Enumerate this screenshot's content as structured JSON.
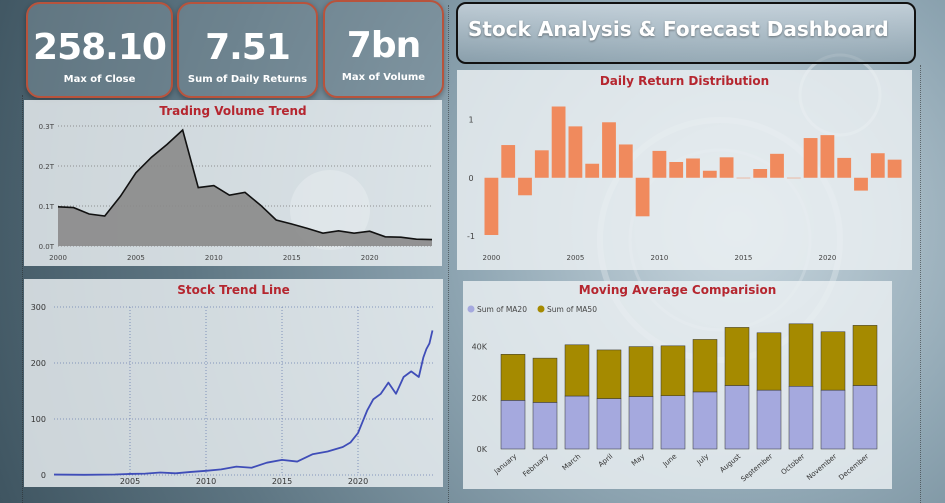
{
  "kpis": [
    {
      "value": "258.10",
      "label": "Max of Close"
    },
    {
      "value": "7.51",
      "label": "Sum of Daily Returns"
    },
    {
      "value": "7bn",
      "label": "Max of Volume"
    }
  ],
  "dashboard_title": "Stock Analysis & Forecast Dashboard",
  "colors": {
    "volume_fill": "#8a8a8a",
    "returns_bar": "#f08a5d",
    "trend_line": "#3f4db8",
    "ma20": "#a5a9de",
    "ma50": "#a58a00",
    "title_red": "#b5262f"
  },
  "chart_data": [
    {
      "type": "area",
      "title": "Trading Volume Trend",
      "x": [
        2000,
        2001,
        2002,
        2003,
        2004,
        2005,
        2006,
        2007,
        2008,
        2009,
        2010,
        2011,
        2012,
        2013,
        2014,
        2015,
        2016,
        2017,
        2018,
        2019,
        2020,
        2021,
        2022,
        2023,
        2024
      ],
      "values": [
        0.098,
        0.096,
        0.08,
        0.075,
        0.124,
        0.183,
        0.222,
        0.254,
        0.29,
        0.146,
        0.151,
        0.127,
        0.134,
        0.102,
        0.065,
        0.055,
        0.044,
        0.032,
        0.038,
        0.032,
        0.037,
        0.023,
        0.022,
        0.017,
        0.016
      ],
      "xticks": [
        "2000",
        "2005",
        "2010",
        "2015",
        "2020"
      ],
      "xtick_values": [
        2000,
        2005,
        2010,
        2015,
        2020
      ],
      "yticks": [
        "0.0T",
        "0.1T",
        "0.2T",
        "0.3T"
      ],
      "ytick_values": [
        0,
        0.1,
        0.2,
        0.3
      ],
      "xlim": [
        2000,
        2024
      ],
      "ylim": [
        0,
        0.3
      ],
      "grid": true
    },
    {
      "type": "bar",
      "title": "Daily Return Distribution",
      "x": [
        2000,
        2001,
        2002,
        2003,
        2004,
        2005,
        2006,
        2007,
        2008,
        2009,
        2010,
        2011,
        2012,
        2013,
        2014,
        2015,
        2016,
        2017,
        2018,
        2019,
        2020,
        2021,
        2022,
        2023,
        2024
      ],
      "values": [
        -0.98,
        0.56,
        -0.3,
        0.47,
        1.22,
        0.88,
        0.24,
        0.95,
        0.57,
        -0.66,
        0.46,
        0.27,
        0.33,
        0.12,
        0.35,
        0.0,
        0.15,
        0.41,
        0.0,
        0.68,
        0.73,
        0.34,
        -0.22,
        0.42,
        0.31
      ],
      "xticks": [
        "2000",
        "2005",
        "2010",
        "2015",
        "2020"
      ],
      "xtick_values": [
        2000,
        2005,
        2010,
        2015,
        2020
      ],
      "yticks": [
        "-1",
        "0",
        "1"
      ],
      "ytick_values": [
        -1,
        0,
        1
      ],
      "ylim": [
        -1.1,
        1.4
      ],
      "grid": false
    },
    {
      "type": "line",
      "title": "Stock Trend Line",
      "x": [
        2000,
        2002,
        2004,
        2005,
        2006,
        2007,
        2008,
        2009,
        2010,
        2011,
        2012,
        2013,
        2014,
        2015,
        2016,
        2017,
        2018,
        2019,
        2019.5,
        2020,
        2020.3,
        2020.6,
        2021,
        2021.5,
        2022,
        2022.5,
        2023,
        2023.5,
        2024,
        2024.3,
        2024.5,
        2024.7,
        2024.9
      ],
      "values": [
        0.8,
        0.3,
        0.9,
        1.9,
        2.5,
        4.5,
        3.0,
        5.5,
        7.5,
        10.0,
        15.0,
        13.0,
        22.0,
        27.0,
        24.0,
        37.0,
        42.0,
        50.0,
        58.0,
        75.0,
        95.0,
        115.0,
        135.0,
        145.0,
        165.0,
        145.0,
        175.0,
        185.0,
        175.0,
        210.0,
        225.0,
        235.0,
        258.1
      ],
      "xticks": [
        "2005",
        "2010",
        "2015",
        "2020"
      ],
      "xtick_values": [
        2005,
        2010,
        2015,
        2020
      ],
      "yticks": [
        "0",
        "100",
        "200",
        "300"
      ],
      "ytick_values": [
        0,
        100,
        200,
        300
      ],
      "xlim": [
        2000,
        2025
      ],
      "ylim": [
        0,
        300
      ],
      "grid": true
    },
    {
      "type": "bar",
      "title": "Moving Average Comparision",
      "categories": [
        "January",
        "February",
        "March",
        "April",
        "May",
        "June",
        "July",
        "August",
        "September",
        "October",
        "November",
        "December"
      ],
      "series": [
        {
          "name": "Sum of MA20",
          "values": [
            19000,
            18200,
            20700,
            19700,
            20500,
            20800,
            22300,
            24800,
            23000,
            24500,
            23000,
            24800
          ]
        },
        {
          "name": "Sum of MA50",
          "values": [
            18000,
            17300,
            20000,
            19000,
            19500,
            19500,
            20500,
            22700,
            22400,
            24400,
            22800,
            23500
          ]
        }
      ],
      "stacked": true,
      "yticks": [
        "0K",
        "20K",
        "40K"
      ],
      "ytick_values": [
        0,
        20000,
        40000
      ],
      "ylim": [
        0,
        50000
      ],
      "legend": "top-left"
    }
  ]
}
